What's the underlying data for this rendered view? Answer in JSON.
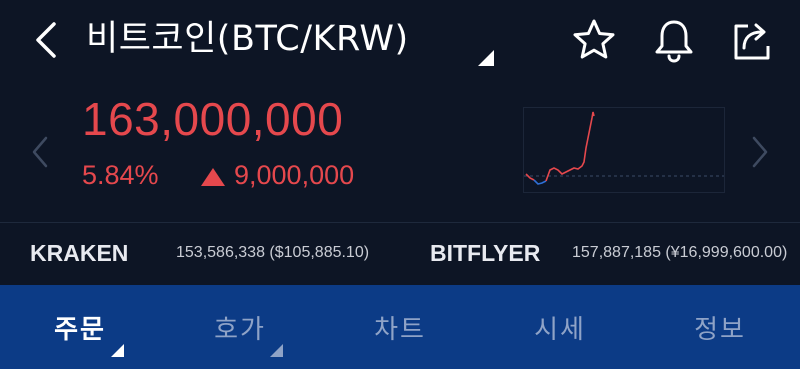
{
  "header": {
    "title": "비트코인(BTC/KRW)",
    "icons": [
      "back-icon",
      "star-icon",
      "bell-icon",
      "share-icon"
    ]
  },
  "ticker": {
    "price": "163,000,000",
    "change_rate": "5.84%",
    "change_amount": "9,000,000",
    "direction": "up"
  },
  "exchanges": [
    {
      "name": "KRAKEN",
      "value": "153,586,338 ($105,885.10)"
    },
    {
      "name": "BITFLYER",
      "value": "157,887,185 (¥16,999,600.00)"
    }
  ],
  "tabs": [
    {
      "label": "주문",
      "active": true
    },
    {
      "label": "호가",
      "active": false
    },
    {
      "label": "차트",
      "active": false
    },
    {
      "label": "시세",
      "active": false
    },
    {
      "label": "정보",
      "active": false
    }
  ],
  "colors": {
    "background": "#0d1525",
    "up": "#e5484d",
    "down": "#2f6fd6",
    "tabbar": "#0c3b86"
  }
}
